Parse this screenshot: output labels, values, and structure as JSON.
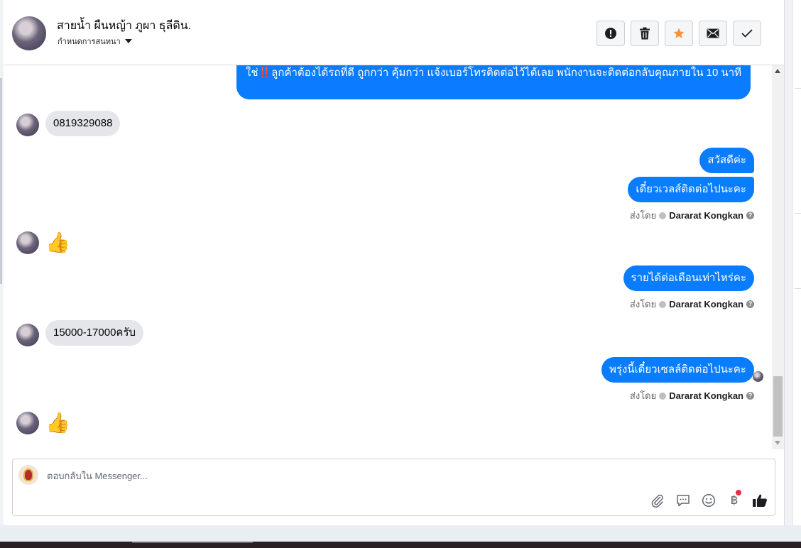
{
  "header": {
    "contact_name": "สายน้ำ ผืนหญ้า ภูผา ธุลีดิน.",
    "assign_label": "กำหนดการสนทนา",
    "actions": [
      {
        "name": "report-icon"
      },
      {
        "name": "trash-icon"
      },
      {
        "name": "star-icon"
      },
      {
        "name": "envelope-icon"
      },
      {
        "name": "check-icon"
      }
    ]
  },
  "messages": {
    "top_partial": "ใช่‼️ลูกค้าต้องได้รถที่ดี ถูกกว่า คุ้มกว่า แจ้งเบอร์โทรติดต่อไว้ได้เลย พนักงานจะติดต่อกลับคุณภายใน 10 นาที",
    "in_phone": "0819329088",
    "out_hello": "สวัสดีค่ะ",
    "out_contact_later": "เดี๋ยวเวลส์ติดต่อไปนะคะ",
    "sent_by_label": "ส่งโดย",
    "agent_name": "Dararat Kongkan",
    "emoji_like": "👍",
    "out_income_question": "รายได้ต่อเดือนเท่าไหร่คะ",
    "in_income": "15000-17000ครับ",
    "out_tomorrow": "พรุ่งนี้เดี๋ยวเซลล์ติดต่อไปนะคะ"
  },
  "composer": {
    "placeholder": "ตอบกลับใน Messenger...",
    "currency_symbol": "฿",
    "icons": [
      "paperclip-icon",
      "saved-reply-icon",
      "emoji-icon",
      "payment-icon",
      "like-icon"
    ],
    "notification_dot_color": "#f02849"
  },
  "colors": {
    "outgoing_bubble": "#0a7cff",
    "incoming_bubble": "#e4e6eb",
    "star": "#f7923b"
  }
}
